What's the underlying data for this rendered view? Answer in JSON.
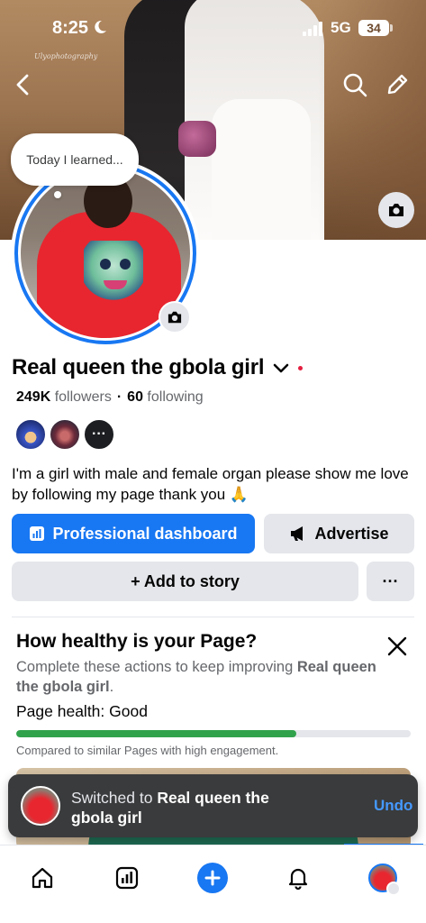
{
  "status_bar": {
    "time": "8:25",
    "network": "5G",
    "battery": "34"
  },
  "cover": {
    "watermark": "Ulyophotography"
  },
  "header": {
    "back_icon": "chevron-left-icon",
    "search_icon": "search-icon",
    "edit_icon": "pencil-icon",
    "cover_camera_icon": "camera-icon"
  },
  "profile": {
    "thought_bubble": "Today I learned...",
    "name": "Real queen the gbola girl",
    "followers_count": "249K",
    "followers_label": "followers",
    "following_count": "60",
    "following_label": "following",
    "friends_more": "···",
    "bio": "I'm a girl with male and female organ please show me love by following my page thank you 🙏"
  },
  "actions": {
    "professional_dashboard": "Professional dashboard",
    "advertise": "Advertise",
    "add_to_story": "+ Add to story",
    "more": "···"
  },
  "health": {
    "title": "How healthy is your Page?",
    "desc_prefix": "Complete these actions to keep improving ",
    "desc_page": "Real queen the gbola girl",
    "desc_suffix": ".",
    "status_label": "Page health:",
    "status_value": "Good",
    "progress_fraction": 0.71,
    "note": "Compared to similar Pages with high engagement."
  },
  "toast": {
    "prefix": "Switched to ",
    "page_name": "Real queen the gbola girl",
    "undo": "Undo"
  },
  "bottom_nav": [
    "home-icon",
    "dashboard-icon",
    "create-icon",
    "notifications-icon",
    "profile-icon"
  ],
  "colors": {
    "accent": "#1877f2",
    "health_good": "#31a24c",
    "toast_bg": "#3a3b3c",
    "undo": "#4599ff"
  }
}
